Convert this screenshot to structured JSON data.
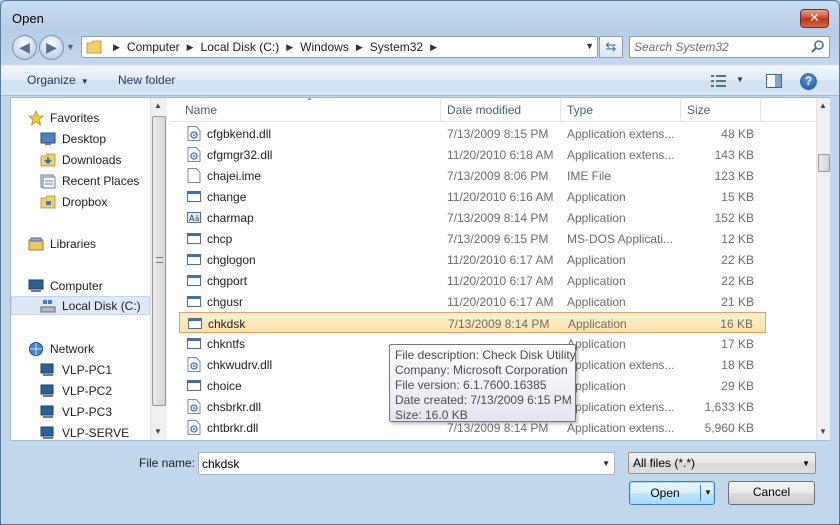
{
  "window": {
    "title": "Open",
    "close_label": "✕"
  },
  "address": {
    "crumbs": [
      "Computer",
      "Local Disk (C:)",
      "Windows",
      "System32"
    ],
    "search_placeholder": "Search System32"
  },
  "toolbar": {
    "organize_label": "Organize",
    "new_folder_label": "New folder",
    "help_label": "?"
  },
  "nav": {
    "favorites_label": "Favorites",
    "favorites": [
      "Desktop",
      "Downloads",
      "Recent Places",
      "Dropbox"
    ],
    "libraries_label": "Libraries",
    "computer_label": "Computer",
    "computer_items": [
      "Local Disk (C:)"
    ],
    "network_label": "Network",
    "network_items": [
      "VLP-PC1",
      "VLP-PC2",
      "VLP-PC3",
      "VLP-SERVE"
    ]
  },
  "columns": {
    "name": "Name",
    "date": "Date modified",
    "type": "Type",
    "size": "Size"
  },
  "files": [
    {
      "name": "cfgbkend.dll",
      "date": "7/13/2009 8:15 PM",
      "type": "Application extens...",
      "size": "48 KB",
      "icon": "dll-icon"
    },
    {
      "name": "cfgmgr32.dll",
      "date": "11/20/2010 6:18 AM",
      "type": "Application extens...",
      "size": "143 KB",
      "icon": "dll-icon"
    },
    {
      "name": "chajei.ime",
      "date": "7/13/2009 8:06 PM",
      "type": "IME File",
      "size": "123 KB",
      "icon": "file-icon"
    },
    {
      "name": "change",
      "date": "11/20/2010 6:16 AM",
      "type": "Application",
      "size": "15 KB",
      "icon": "app-icon"
    },
    {
      "name": "charmap",
      "date": "7/13/2009 8:14 PM",
      "type": "Application",
      "size": "152 KB",
      "icon": "charmap-icon"
    },
    {
      "name": "chcp",
      "date": "7/13/2009 6:15 PM",
      "type": "MS-DOS Applicati...",
      "size": "12 KB",
      "icon": "app-icon"
    },
    {
      "name": "chglogon",
      "date": "11/20/2010 6:17 AM",
      "type": "Application",
      "size": "22 KB",
      "icon": "app-icon"
    },
    {
      "name": "chgport",
      "date": "11/20/2010 6:17 AM",
      "type": "Application",
      "size": "22 KB",
      "icon": "app-icon"
    },
    {
      "name": "chgusr",
      "date": "11/20/2010 6:17 AM",
      "type": "Application",
      "size": "21 KB",
      "icon": "app-icon"
    },
    {
      "name": "chkdsk",
      "date": "7/13/2009 8:14 PM",
      "type": "Application",
      "size": "16 KB",
      "icon": "app-icon"
    },
    {
      "name": "chkntfs",
      "date": "",
      "type": "Application",
      "size": "17 KB",
      "icon": "app-icon"
    },
    {
      "name": "chkwudrv.dll",
      "date": "",
      "type": "Application extens...",
      "size": "18 KB",
      "icon": "dll-icon"
    },
    {
      "name": "choice",
      "date": "",
      "type": "Application",
      "size": "29 KB",
      "icon": "app-icon"
    },
    {
      "name": "chsbrkr.dll",
      "date": "",
      "type": "Application extens...",
      "size": "1,633 KB",
      "icon": "dll-icon"
    },
    {
      "name": "chtbrkr.dll",
      "date": "7/13/2009 8:14 PM",
      "type": "Application extens...",
      "size": "5,960 KB",
      "icon": "dll-icon"
    }
  ],
  "selected_index": 9,
  "tooltip": {
    "description": "File description: Check Disk Utility",
    "company": "Company: Microsoft Corporation",
    "version": "File version: 6.1.7600.16385",
    "created": "Date created: 7/13/2009 6:15 PM",
    "size": "Size: 16.0 KB"
  },
  "footer": {
    "file_name_label": "File name:",
    "file_name_value": "chkdsk",
    "filter_value": "All files (*.*)",
    "open_label": "Open",
    "cancel_label": "Cancel"
  },
  "colors": {
    "selection_bg": "#fbe3a8",
    "selection_border": "#e89f6e",
    "link": "#1e395b"
  }
}
